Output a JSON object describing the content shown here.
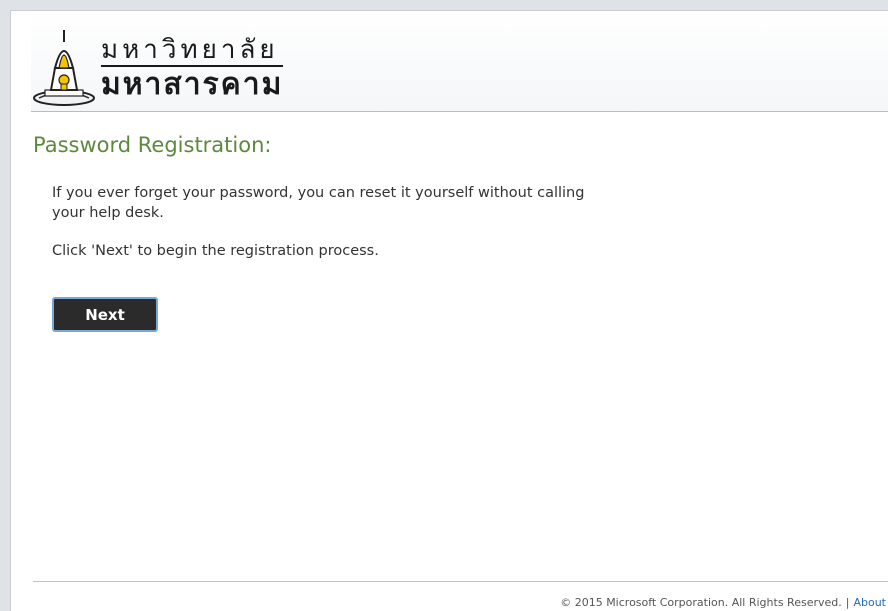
{
  "header": {
    "logo_line1": "มหาวิทยาลัย",
    "logo_line2": "มหาสารคาม"
  },
  "main": {
    "title": "Password Registration:",
    "paragraph1": "If you ever forget your password, you can reset it yourself without calling your help desk.",
    "paragraph2": "Click 'Next' to begin the registration process.",
    "next_label": "Next"
  },
  "footer": {
    "copyright": "© 2015 Microsoft Corporation. All Rights Reserved.",
    "separator": "|",
    "about_label": "About"
  },
  "colors": {
    "title_green": "#5b8a3c",
    "button_bg": "#2b2b2b",
    "divider_blue": "#9cc3df",
    "link_blue": "#1f6eb8"
  }
}
